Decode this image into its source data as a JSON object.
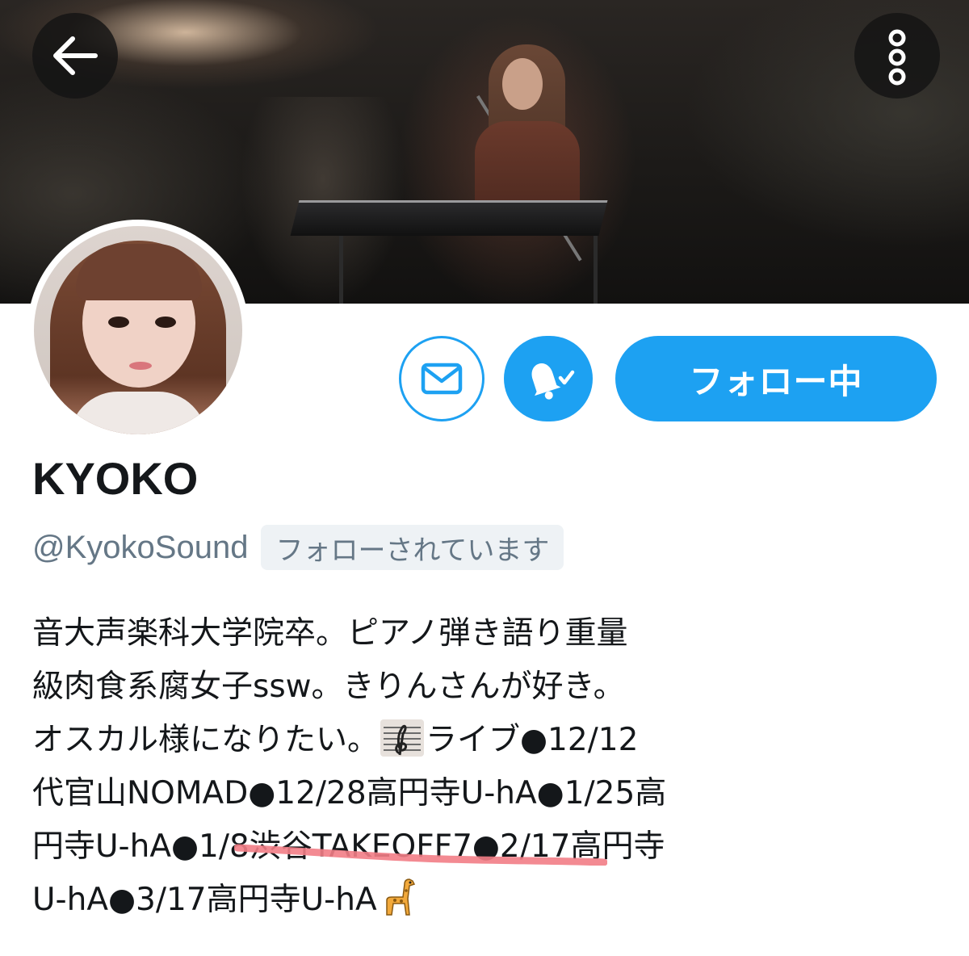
{
  "header": {
    "back_icon": "arrow-left-icon",
    "more_icon": "more-vertical-icon"
  },
  "profile": {
    "avatar_icon": "avatar",
    "display_name": "KYOKO",
    "handle": "@KyokoSound",
    "follows_you_badge": "フォローされています"
  },
  "actions": {
    "message_icon": "mail-icon",
    "notify_icon": "bell-check-icon",
    "follow_label": "フォロー中"
  },
  "bio": {
    "lines": [
      {
        "text": "音大声楽科大学院卒。ピアノ弾き語り重量"
      },
      {
        "text": "級肉食系腐女子ssw。きりんさんが好き。"
      },
      {
        "before": "オスカル様になりたい。",
        "icon": "musical-score-emoji",
        "after": "ライブ●12/12"
      },
      {
        "text": "代官山NOMAD●12/28高円寺U-hA●1/25高"
      },
      {
        "text": "円寺U-hA●1/8渋谷TAKEOFF7●2/17高円寺"
      },
      {
        "before": "U-hA●3/17高円寺U-hA",
        "icon": "giraffe-emoji",
        "after": ""
      }
    ],
    "highlight_color": "#f27d86"
  },
  "colors": {
    "accent": "#1da1f2",
    "text": "#14171a",
    "muted": "#657786",
    "badge_bg": "#eef2f5"
  }
}
